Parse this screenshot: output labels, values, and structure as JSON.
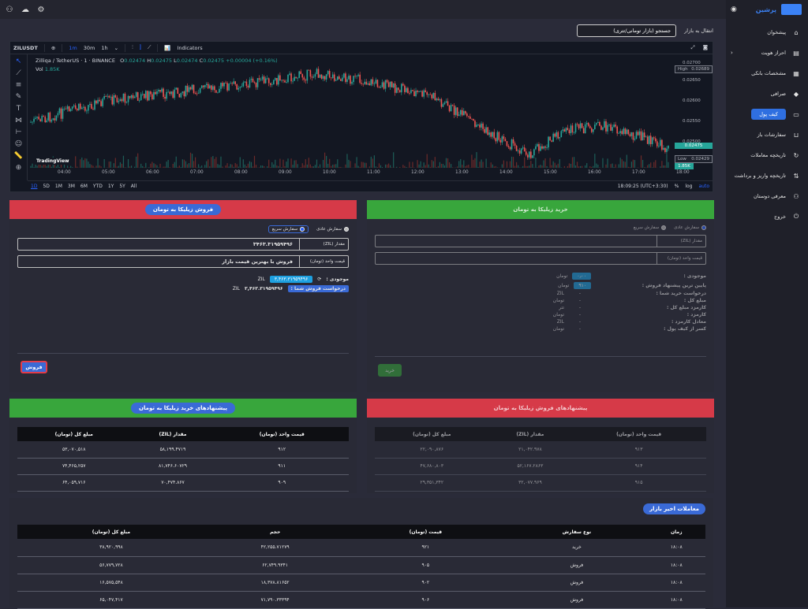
{
  "sidebar": {
    "brand": "پرشین",
    "items": [
      {
        "label": "پیشخوان",
        "icon": "home-icon"
      },
      {
        "label": "احراز هویت",
        "icon": "id-card-icon"
      },
      {
        "label": "مشخصات بانکی",
        "icon": "bank-icon"
      },
      {
        "label": "صرافی",
        "icon": "exchange-icon"
      },
      {
        "label": "کیف پول",
        "icon": "wallet-icon"
      },
      {
        "label": "سفارشات باز",
        "icon": "cart-icon"
      },
      {
        "label": "تاریخچه معاملات",
        "icon": "history-icon"
      },
      {
        "label": "تاریخچه واریز و برداشت",
        "icon": "transfer-icon"
      },
      {
        "label": "معرفی دوستان",
        "icon": "users-icon"
      },
      {
        "label": "خروج",
        "icon": "power-icon"
      }
    ],
    "active_index": 4
  },
  "market": {
    "label": "انتقال به بازار",
    "search_value": "جستجو (بازار تومانی/تتری)"
  },
  "chart": {
    "symbol": "ZILUSDT",
    "intervals": [
      "1m",
      "30m",
      "1h"
    ],
    "active_interval": "1m",
    "indicators_label": "Indicators",
    "title": "Zilliqa / TetherUS · 1 · BINANCE",
    "ohlc": {
      "o": "0.02474",
      "h": "0.02475",
      "l": "0.02474",
      "c": "0.02475",
      "change": "+0.00004 (+0.16%)"
    },
    "vol_label": "Vol",
    "vol_value": "1.85K",
    "tradingview": "TradingView",
    "y_ticks": [
      "0.02700",
      "0.02650",
      "0.02600",
      "0.02550",
      "0.02500",
      "0.02450"
    ],
    "high_label": "High",
    "high_value": "0.02689",
    "last_value": "0.02475",
    "low_label": "Low",
    "low_value": "0.02429",
    "vol_tag": "1.85K",
    "x_ticks": [
      "04:00",
      "05:00",
      "06:00",
      "07:00",
      "08:00",
      "09:00",
      "10:00",
      "11:00",
      "12:00",
      "13:00",
      "14:00",
      "15:00",
      "16:00",
      "17:00",
      "18:00"
    ],
    "ranges": [
      "1D",
      "5D",
      "1M",
      "3M",
      "6M",
      "YTD",
      "1Y",
      "5Y",
      "All"
    ],
    "clock": "18:09:25 (UTC+3:30)",
    "pct": "%",
    "log": "log",
    "auto": "auto"
  },
  "buy_panel": {
    "title": "خرید زیلیکا به تومان",
    "order_types": [
      "سفارش عادی",
      "سفارش سریع"
    ],
    "amount_label": "مقدار (ZIL)",
    "price_label": "قیمت واحد (تومان)",
    "info": [
      {
        "k": "موجودی :",
        "v": "۰٫۰۰",
        "u": "تومان"
      },
      {
        "k": "پایین ترین پیشنهاد فروش :",
        "v": "۹۱۰",
        "u": "تومان"
      },
      {
        "k": "درخواست خرید شما :",
        "v": "-",
        "u": "ZIL"
      },
      {
        "k": "مبلغ کل :",
        "v": "-",
        "u": "تومان"
      },
      {
        "k": "کارمزد مبلغ کل :",
        "v": "-",
        "u": "تتر"
      },
      {
        "k": "کارمزد :",
        "v": "-",
        "u": "تومان"
      },
      {
        "k": "معادل کارمزد :",
        "v": "-",
        "u": "ZIL"
      },
      {
        "k": "کسر از کیف پول :",
        "v": "-",
        "u": "تومان"
      }
    ],
    "submit": "خرید"
  },
  "sell_panel": {
    "title": "فروش زیلیکا به تومان",
    "order_types": [
      "سفارش عادی",
      "سفارش سریع"
    ],
    "amount_label": "مقدار (ZIL)",
    "amount_value": "۳۴۶۳.۳۱۹۵۹۴۹۶",
    "price_label": "قیمت واحد (تومان)",
    "price_value": "فروش با بهترین قیمت بازار",
    "balance_label": "موجودی :",
    "balance_value": "۳,۴۶۳.۳۱۹۵۹۴۹۶",
    "balance_unit": "ZIL",
    "request_label": "درخواست فروش شما :",
    "request_value": "۳,۴۶۳.۳۱۹۵۹۴۹۶",
    "request_unit": "ZIL",
    "submit": "فروش"
  },
  "buy_offers": {
    "title": "پیشنهادهای خرید زیلیکا به تومان",
    "columns": [
      "قیمت واحد (تومان)",
      "مقدار (ZIL)",
      "مبلغ کل (تومان)"
    ],
    "rows": [
      [
        "۹۱۲",
        "۵۸,۱۹۹.۴۷۱۹",
        "۵۳,۰۷۰,۵۱۸"
      ],
      [
        "۹۱۱",
        "۸۱,۷۴۶.۶۰۷۲۹",
        "۷۴,۴۶۵,۲۵۷"
      ],
      [
        "۹۰۹",
        "۷۰,۴۷۴.۸۶۷",
        "۶۴,۰۵۹,۷۱۶"
      ]
    ]
  },
  "sell_offers": {
    "title": "پیشنهادهای فروش زیلیکا به تومان",
    "columns": [
      "قیمت واحد (تومان)",
      "مقدار (ZIL)",
      "مبلغ کل (تومان)"
    ],
    "rows": [
      [
        "۹۱۳",
        "۲۱,۰۴۲.۹۷۸",
        "۲۲,۰۹۰,۸۷۶"
      ],
      [
        "۹۱۴",
        "۵۲,۱۶۷.۲۸۶۳",
        "۴۷,۶۸۰,۸۰۳"
      ],
      [
        "۹۱۵",
        "۳۲,۰۷۷.۹۶۹",
        "۲۹,۳۵۱,۳۴۲"
      ]
    ]
  },
  "recent_trades": {
    "title": "معاملات اخیر بازار",
    "columns": [
      "زمان",
      "نوع سفارش",
      "قیمت (تومان)",
      "حجم",
      "مبلغ کل (تومان)"
    ],
    "rows": [
      [
        "۱۸:۰۸",
        "خرید",
        "۹۲۱",
        "۴۲,۲۵۵.۷۱۲۷۹",
        "۳۸,۹۲۰,۹۹۸"
      ],
      [
        "۱۸:۰۸",
        "فروش",
        "۹۰۵",
        "۶۲,۷۴۹.۹۳۴۱",
        "۵۶,۷۷۹,۷۲۸"
      ],
      [
        "۱۸:۰۸",
        "فروش",
        "۹۰۲",
        "۱۸,۳۷۸.۸۱۶۵۲",
        "۱۶,۵۷۵,۵۴۸"
      ],
      [
        "۱۸:۰۸",
        "فروش",
        "۹۰۶",
        "۷۱,۷۹۰.۳۳۳۹۴",
        "۶۵,۰۴۷,۴۱۷"
      ]
    ]
  }
}
